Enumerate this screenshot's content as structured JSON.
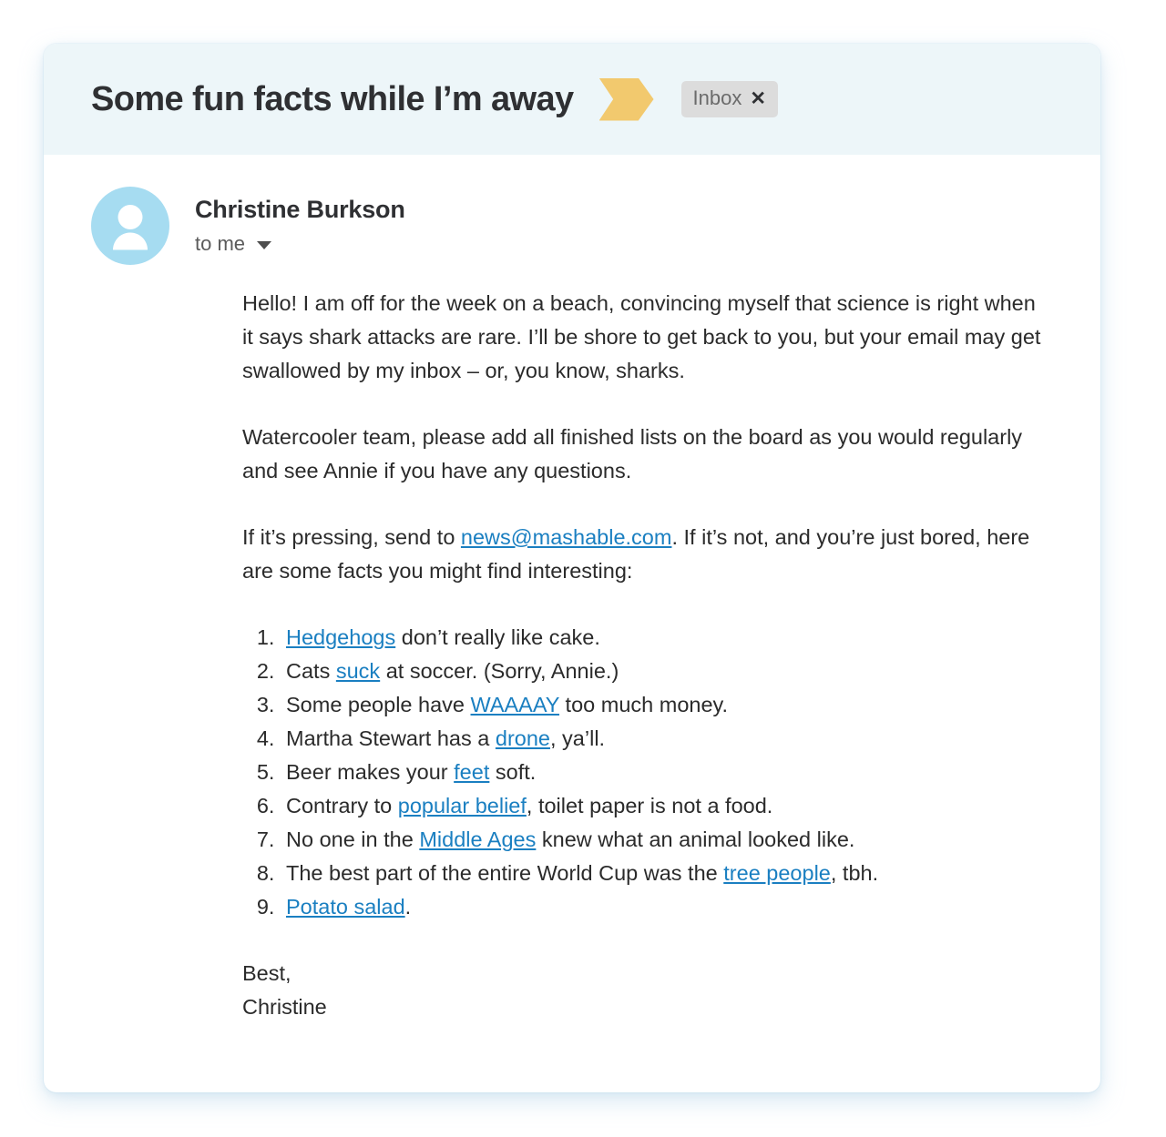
{
  "header": {
    "subject": "Some fun facts while I’m away",
    "marker_icon": "chevron-right-flag-icon",
    "label_chip": {
      "text": "Inbox",
      "close_glyph": "✕"
    },
    "background_color": "#edf6f9",
    "marker_color": "#f2c96e",
    "chip_color": "#dcdcdc"
  },
  "sender": {
    "avatar_icon": "person-avatar-icon",
    "avatar_color": "#a6dcf1",
    "name": "Christine Burkson",
    "recipient": "to me",
    "caret_icon": "chevron-down-icon"
  },
  "body": {
    "paragraph_1": "Hello! I am off for the week on a beach, convincing myself that science is right when it says shark attacks are rare. I’ll be shore to get back to you, but your email may get swallowed by my inbox – or, you know, sharks.",
    "paragraph_2": "Watercooler team, please add all finished lists on the board as you would regularly and see Annie if you have any questions.",
    "paragraph_3_before": "If it’s pressing, send to ",
    "paragraph_3_link": "news@mashable.com",
    "paragraph_3_after": ". If it’s not, and you’re just bored, here are some facts you might find interesting:",
    "link_color": "#1a7fc1",
    "facts": [
      {
        "before": "",
        "link": "Hedgehogs",
        "after": " don’t really like cake."
      },
      {
        "before": "Cats ",
        "link": "suck",
        "after": " at soccer. (Sorry, Annie.)"
      },
      {
        "before": "Some people have ",
        "link": "WAAAAY",
        "after": " too much money."
      },
      {
        "before": "Martha Stewart has a ",
        "link": "drone",
        "after": ", ya’ll."
      },
      {
        "before": "Beer makes your ",
        "link": "feet",
        "after": " soft."
      },
      {
        "before": "Contrary to ",
        "link": "popular belief",
        "after": ", toilet paper is not a food."
      },
      {
        "before": "No one in the ",
        "link": "Middle Ages",
        "after": " knew what an animal looked like."
      },
      {
        "before": "The best part of the entire World Cup was the ",
        "link": "tree people",
        "after": ", tbh."
      },
      {
        "before": "",
        "link": "Potato salad",
        "after": "."
      }
    ],
    "signoff": "Best,",
    "signature_name": "Christine"
  }
}
